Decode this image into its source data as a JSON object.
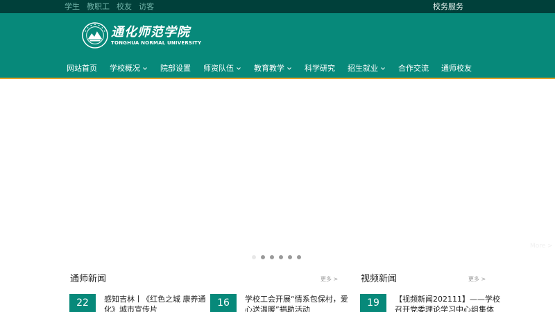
{
  "topbar": {
    "links": [
      "学生",
      "教职工",
      "校友",
      "访客"
    ],
    "service": "校务服务"
  },
  "logo": {
    "name_cn": "通化师范学院",
    "name_en": "TONGHUA NORMAL UNIVERSITY",
    "seal_icon": "university-seal-icon"
  },
  "nav": {
    "items": [
      {
        "label": "网站首页",
        "has_dropdown": false
      },
      {
        "label": "学校概况",
        "has_dropdown": true
      },
      {
        "label": "院部设置",
        "has_dropdown": false
      },
      {
        "label": "师资队伍",
        "has_dropdown": true
      },
      {
        "label": "教育教学",
        "has_dropdown": true
      },
      {
        "label": "科学研究",
        "has_dropdown": false
      },
      {
        "label": "招生就业",
        "has_dropdown": true
      },
      {
        "label": "合作交流",
        "has_dropdown": false
      },
      {
        "label": "通师校友",
        "has_dropdown": false
      }
    ]
  },
  "banner": {
    "slide_count": 6,
    "active_slide": 1,
    "more_label": "More >"
  },
  "news_section": {
    "title": "通师新闻",
    "more": "更多 >",
    "items": [
      {
        "day": "22",
        "title_line1": "感知吉林丨《红色之城 康养通",
        "title_line2": "化》城市宣传片"
      },
      {
        "day": "16",
        "title_line1": "学校工会开展“情系包保村，爱",
        "title_line2": "心送温暖”捐助活动"
      }
    ]
  },
  "video_section": {
    "title": "视频新闻",
    "more": "更多 >",
    "items": [
      {
        "day": "19",
        "title_line1": "【视频新闻202111】——学校",
        "title_line2": "召开党委理论学习中心组集体"
      }
    ]
  },
  "colors": {
    "topbar": "#00403a",
    "header": "#07897a",
    "accent": "#e5a22b",
    "date_box": "#07897a"
  }
}
